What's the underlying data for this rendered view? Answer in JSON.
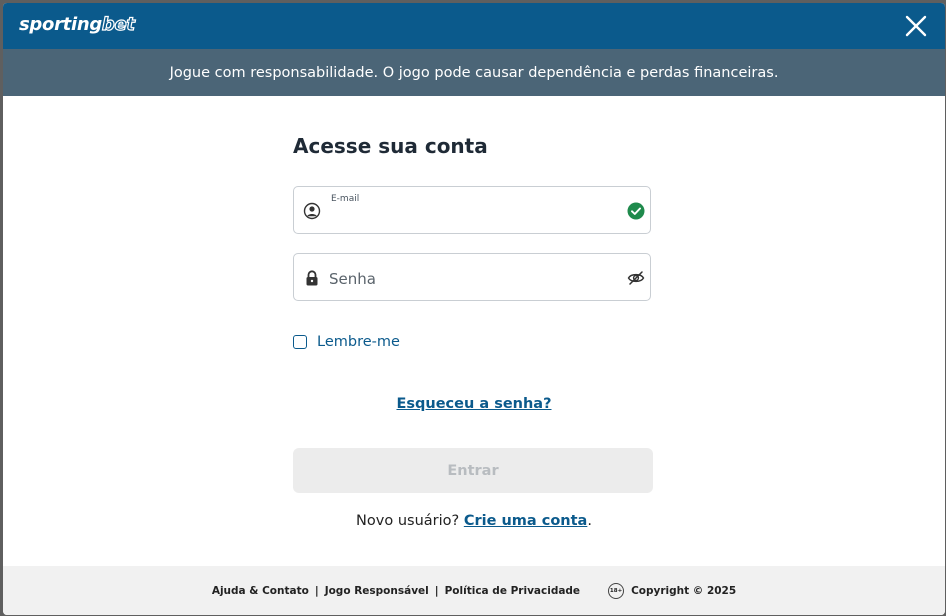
{
  "header": {
    "logo_main": "sporting",
    "logo_accent": "bet",
    "close_icon": "close-icon"
  },
  "banner": {
    "text": "Jogue com responsabilidade. O jogo pode causar dependência e perdas financeiras."
  },
  "login": {
    "title": "Acesse sua conta",
    "email_label": "E-mail",
    "email_value": "",
    "password_placeholder": "Senha",
    "remember_label": "Lembre-me",
    "forgot_link": "Esqueceu a senha?",
    "submit_label": "Entrar",
    "signup_prefix": "Novo usuário?",
    "signup_link": "Crie uma conta",
    "signup_suffix": "."
  },
  "icons": {
    "user": "user-icon",
    "lock": "lock-icon",
    "valid": "check-circle-icon",
    "eye": "eye-slash-icon",
    "age": "age-18-icon"
  },
  "footer": {
    "links": [
      "Ajuda & Contato",
      "Jogo Responsável",
      "Política de Privacidade"
    ],
    "separator": "|",
    "age_badge": "18+",
    "copyright": "Copyright © 2025"
  },
  "colors": {
    "brand": "#0b5a8c",
    "banner": "#4b6577",
    "valid": "#1f8a4c"
  }
}
